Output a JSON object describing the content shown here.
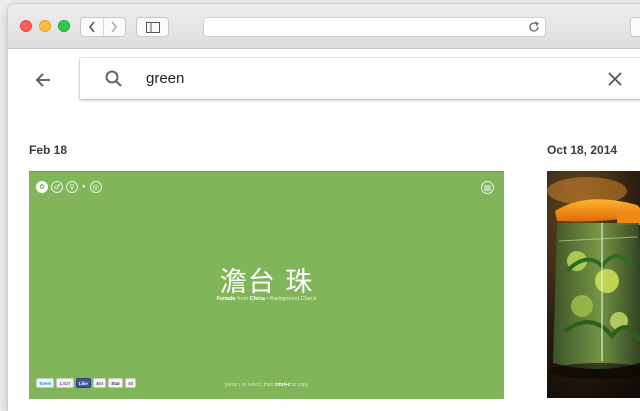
{
  "search": {
    "query": "green"
  },
  "results": [
    {
      "date": "Feb 18",
      "name": "澹台 珠",
      "meta": {
        "gender": "Female",
        "from_label": "from",
        "country": "China",
        "sep": "•",
        "action": "Background Check"
      },
      "hint": {
        "pre": "press",
        "key1": "↕",
        "mid": "to select, then",
        "key2": "cmd+c",
        "post": "to copy"
      },
      "social": {
        "tweet": "Tweet",
        "tweet_count": "1,827",
        "like": "Like",
        "like_count": "464",
        "star": "Star",
        "star_count": "48"
      },
      "bg_color": "#80b55a"
    },
    {
      "date": "Oct 18, 2014"
    }
  ],
  "icons": {
    "back": "arrow-left-icon",
    "search": "search-icon",
    "clear": "close-icon",
    "reload": "reload-icon",
    "sidebar": "sidebar-icon"
  },
  "colors": {
    "card_green": "#80b55a",
    "text_dark": "#3a3a3a"
  }
}
